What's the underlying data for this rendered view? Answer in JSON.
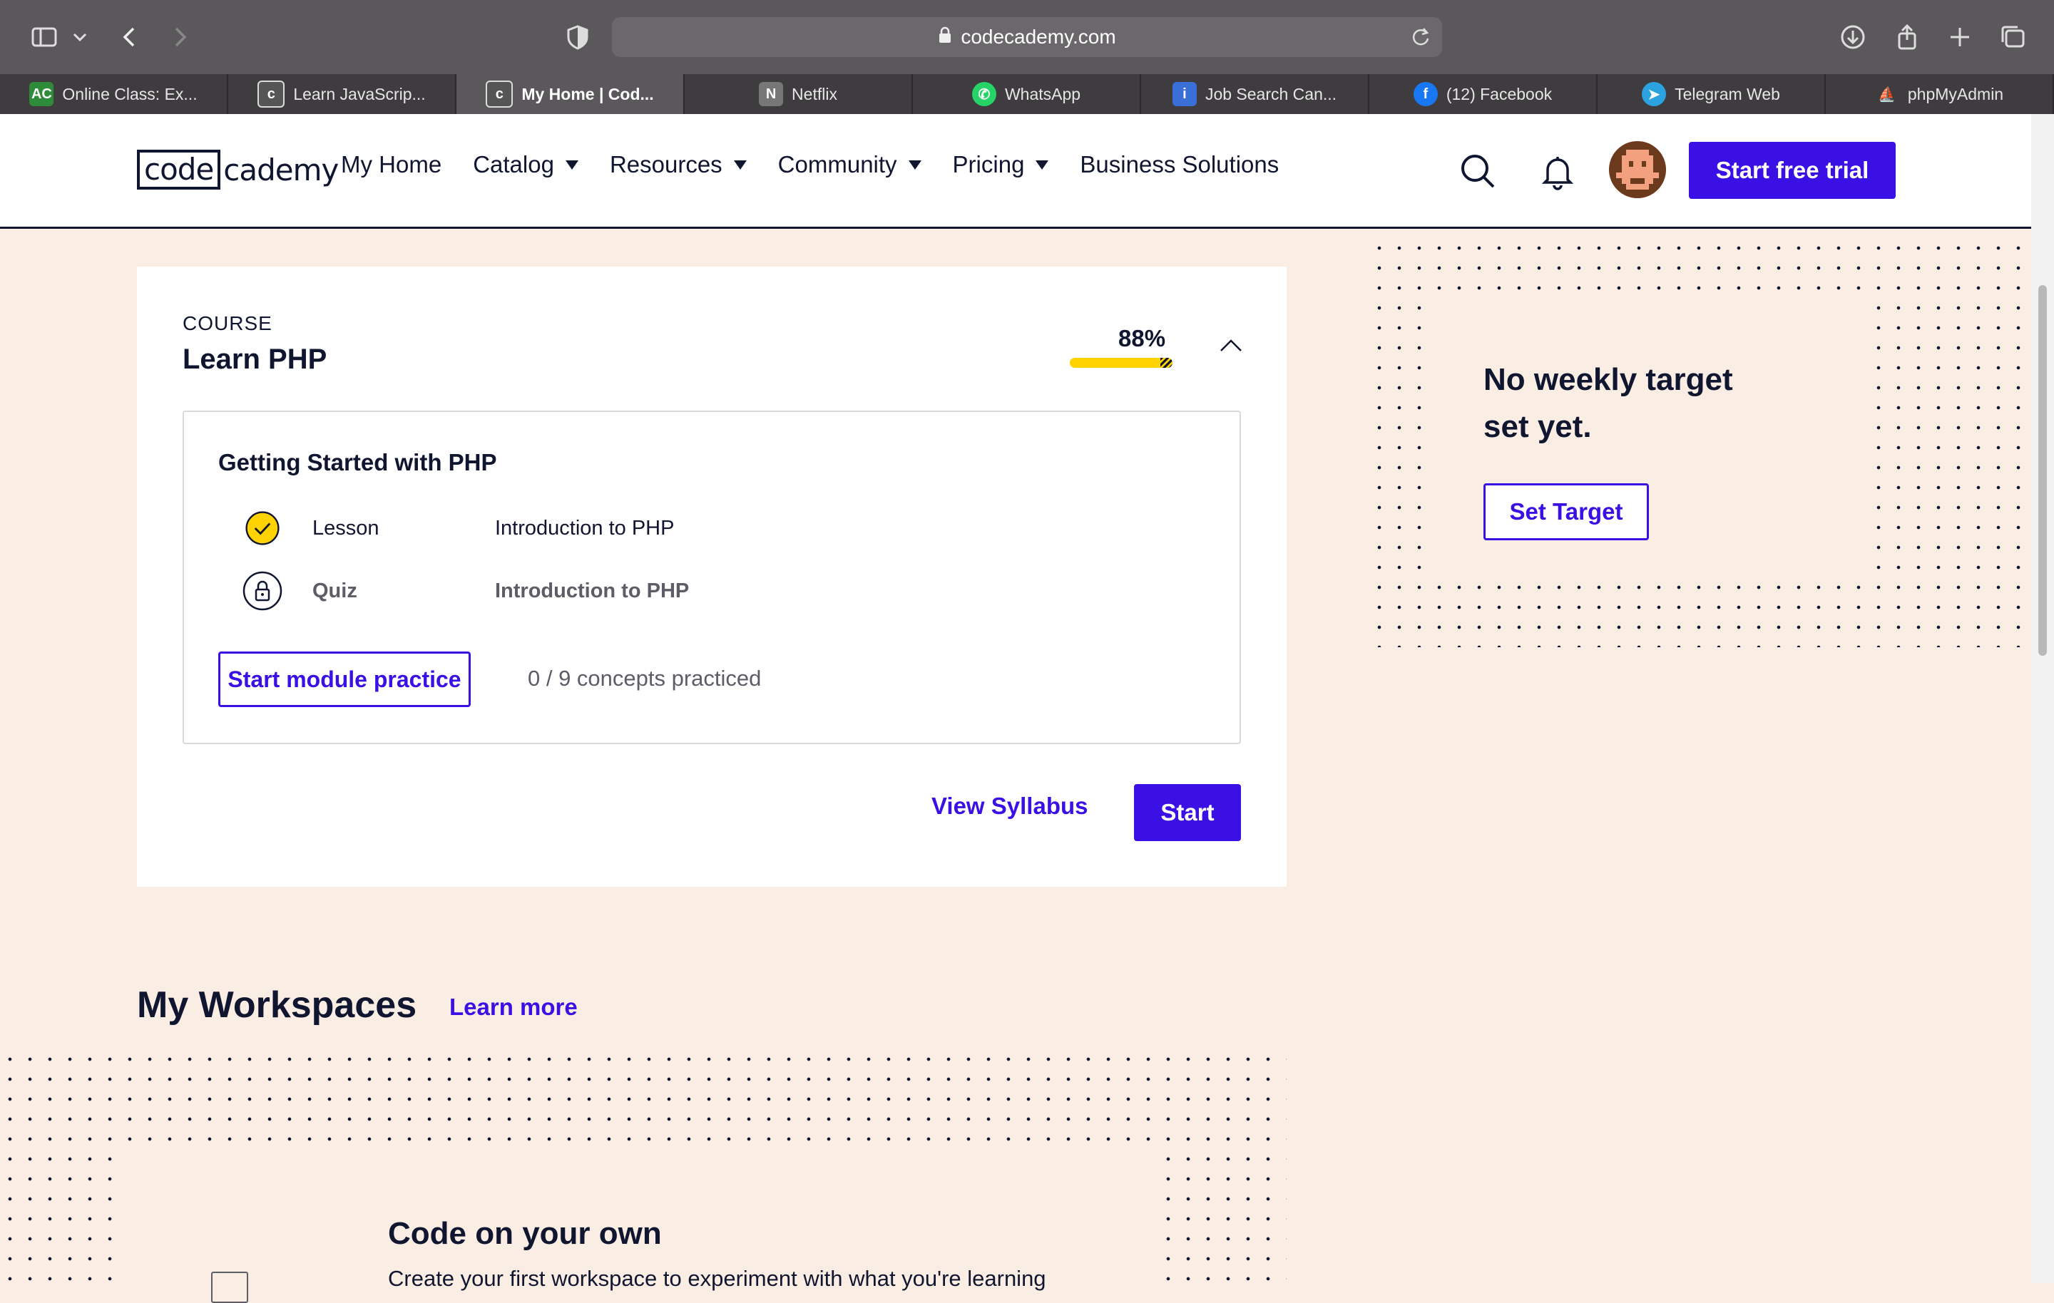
{
  "browser": {
    "url": "codecademy.com",
    "tabs": [
      {
        "title": "Online Class: Ex...",
        "icon": "AC",
        "color": "#2e8b3a"
      },
      {
        "title": "Learn JavaScrip...",
        "icon": "c",
        "color": "#555555"
      },
      {
        "title": "My Home | Cod...",
        "icon": "c",
        "color": "#555555",
        "active": true
      },
      {
        "title": "Netflix",
        "icon": "N",
        "color": "#777777"
      },
      {
        "title": "WhatsApp",
        "icon": "w",
        "color": "#25d366"
      },
      {
        "title": "Job Search Can...",
        "icon": "i",
        "color": "#3b6fd8"
      },
      {
        "title": "(12) Facebook",
        "icon": "f",
        "color": "#1877f2"
      },
      {
        "title": "Telegram Web",
        "icon": "t",
        "color": "#2aa3e0"
      },
      {
        "title": "phpMyAdmin",
        "icon": "p",
        "color": "#e07b1a"
      }
    ]
  },
  "header": {
    "logo_code": "code",
    "logo_academy": "cademy",
    "nav": [
      "My Home",
      "Catalog",
      "Resources",
      "Community",
      "Pricing",
      "Business Solutions"
    ],
    "cta": "Start free trial"
  },
  "course": {
    "kicker": "COURSE",
    "title": "Learn PHP",
    "progress_label": "88%",
    "progress_value": 0.88,
    "module": {
      "title": "Getting Started with PHP",
      "items": [
        {
          "kind": "Lesson",
          "name": "Introduction to PHP",
          "status": "completed"
        },
        {
          "kind": "Quiz",
          "name": "Introduction to PHP",
          "status": "locked"
        }
      ],
      "practice_button": "Start module practice",
      "concepts": "0 / 9 concepts practiced"
    },
    "view_syllabus": "View Syllabus",
    "start": "Start"
  },
  "target": {
    "title": "No weekly target set yet.",
    "button": "Set Target"
  },
  "workspaces": {
    "title": "My Workspaces",
    "learn_more": "Learn more",
    "heading": "Code on your own",
    "description": "Create your first workspace to experiment with what you're learning"
  },
  "colors": {
    "brand_blue": "#3a10e5",
    "navy": "#10162f",
    "page_bg": "#faeee4",
    "progress_yellow": "#ffd300"
  }
}
